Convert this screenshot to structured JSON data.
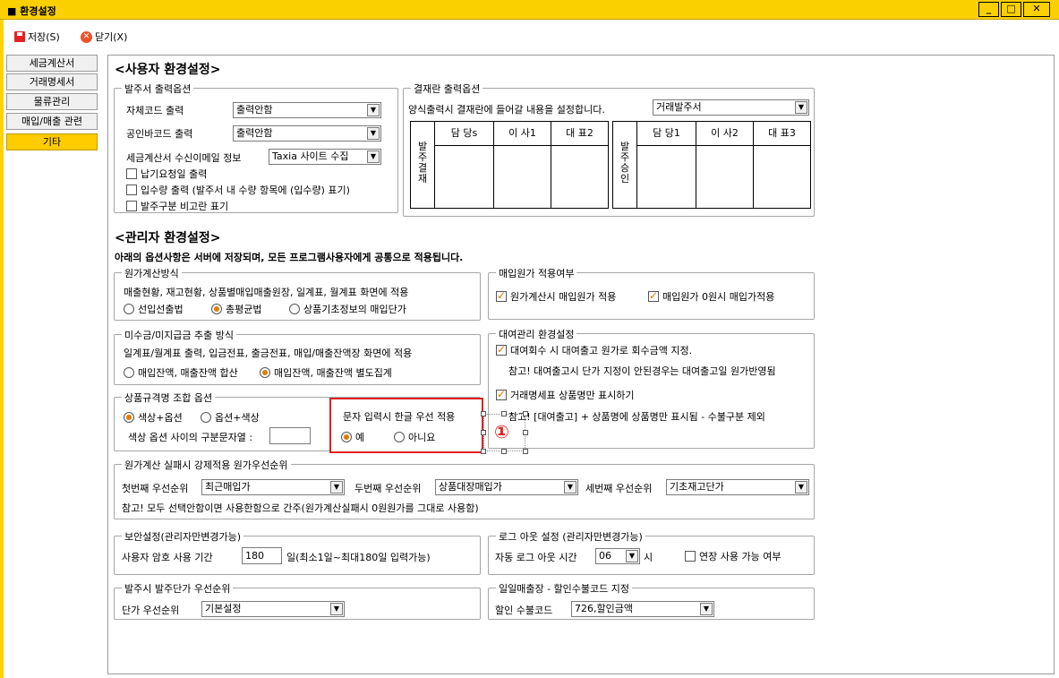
{
  "window": {
    "title": "■ 환경설정",
    "min": "_",
    "max": "□",
    "close": "✕"
  },
  "toolbar": {
    "save": "저장(S)",
    "close": "닫기(X)"
  },
  "nav": [
    "세금계산서",
    "거래명세서",
    "물류관리",
    "매입/매출 관련",
    "기타"
  ],
  "user_section": {
    "title": "<사용자 환경설정>",
    "po": {
      "title": "발주서 출력옵션",
      "own_code_label": "자체코드 출력",
      "own_code_value": "출력안함",
      "barcode_label": "공인바코드 출력",
      "barcode_value": "출력안함",
      "tax_email_label": "세금계산서 수신이메일 정보",
      "tax_email_value": "Taxia 사이트 수집",
      "chk1": "납기요청일 출력",
      "chk2": "입수량 출력 (발주서 내 수량 항목에 (입수량) 표기)",
      "chk3": "발주구분 비고란 표기"
    },
    "approval": {
      "title": "결재란 출력옵션",
      "desc": "양식출력시 결재란에 들어갈 내용을 설정합니다.",
      "combo": "거래발주서",
      "left_label": "발주결재",
      "left_cols": [
        "담 당s",
        "이 사1",
        "대 표2"
      ],
      "right_label": "발주승인",
      "right_cols": [
        "담 당1",
        "이 사2",
        "대 표3"
      ]
    }
  },
  "admin_section": {
    "title": "<관리자 환경설정>",
    "subtitle": "아래의 옵션사항은 서버에 저장되며, 모든 프로그램사용자에게 공통으로 적용됩니다.",
    "cost_calc": {
      "title": "원가계산방식",
      "desc": "매출현황, 재고현황, 상품별매입매출원장, 일계표, 월계표 화면에 적용",
      "opt1": "선입선출법",
      "opt2": "총평균법",
      "opt3": "상품기초정보의 매입단가"
    },
    "purchase_cost": {
      "title": "매입원가 적용여부",
      "chk1": "원가계산시 매입원가 적용",
      "chk2": "매입원가 0원시 매입가적용"
    },
    "receivable": {
      "title": "미수금/미지급금 추출 방식",
      "desc": "일계표/월계표 출력, 입금전표, 출금전표, 매입/매출잔액장 화면에 적용",
      "opt1": "매입잔액, 매출잔액 합산",
      "opt2": "매입잔액, 매출잔액 별도집계"
    },
    "rental": {
      "title": "대여관리 환경설정",
      "chk1": "대여회수 시 대여출고 원가로 회수금액 지정.",
      "note1": "참고! 대여출고시 단가 지정이 안된경우는 대여출고일 원가반영됨",
      "chk2": "거래명세표 상품명만 표시하기",
      "note2": "참고! [대여출고] + 상품명에 상품명만 표시됨 - 수불구분 제외"
    },
    "spec": {
      "title": "상품규격명 조합 옵션",
      "opt1": "색상+옵션",
      "opt2": "옵션+색상",
      "sep_label": "색상 옵션 사이의 구분문자열 :",
      "sep_value": ""
    },
    "korean": {
      "label": "문자 입력시 한글 우선 적용",
      "yes": "예",
      "no": "아니요",
      "marker": "①"
    },
    "cost_fail": {
      "title": "원가계산 실패시 강제적용 원가우선순위",
      "p1_label": "첫번째 우선순위",
      "p1_value": "최근매입가",
      "p2_label": "두번째 우선순위",
      "p2_value": "상품대장매입가",
      "p3_label": "세번째 우선순위",
      "p3_value": "기초재고단가",
      "note": "참고! 모두 선택안함이면 사용한함으로 간주(원가계산실패시 0원원가를 그대로 사용함)"
    },
    "security": {
      "title": "보안설정(관리자만변경가능)",
      "label": "사용자 암호 사용 기간",
      "value": "180",
      "suffix": "일(최소1일~최대180일 입력가능)"
    },
    "logout": {
      "title": "로그 아웃 설정 (관리자만변경가능)",
      "label": "자동 로그 아웃 시간",
      "value": "06",
      "unit": "시",
      "chk": "연장 사용 가능 여부"
    },
    "order_price": {
      "title": "발주시 발주단가 우선순위",
      "label": "단가 우선순위",
      "value": "기본설정"
    },
    "daily_sales": {
      "title": "일일매출장 - 할인수불코드 지정",
      "label": "할인 수불코드",
      "value": "726,할인금액"
    }
  },
  "colors": {
    "titlebar": "#fad000",
    "nav_active": "#ffcc00",
    "accent": "#e07b00",
    "annotation": "#e02020"
  }
}
